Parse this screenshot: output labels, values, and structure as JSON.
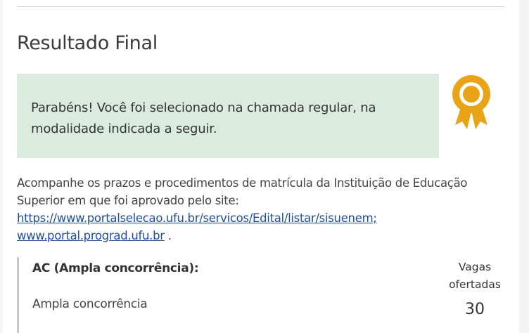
{
  "result": {
    "title": "Resultado Final",
    "success_message": "Parabéns! Você foi selecionado na chamada regular, na modalidade indicada a seguir.",
    "award_icon": "award-ribbon-icon",
    "award_color": "#e8a317",
    "success_bg": "#dcebe0"
  },
  "info": {
    "text_before": "Acompanhe os prazos e procedimentos de matrícula da Instituição de Educação Superior em que foi aprovado pelo site:",
    "link1": "https://www.portalselecao.ufu.br/servicos/Edital/listar/sisuenem;",
    "link2": "www.portal.prograd.ufu.br",
    "text_after": " ."
  },
  "quota": {
    "title": "AC (Ampla concorrência):",
    "description": "Ampla concorrência",
    "seats_label": "Vagas ofertadas",
    "seats_value": "30"
  }
}
